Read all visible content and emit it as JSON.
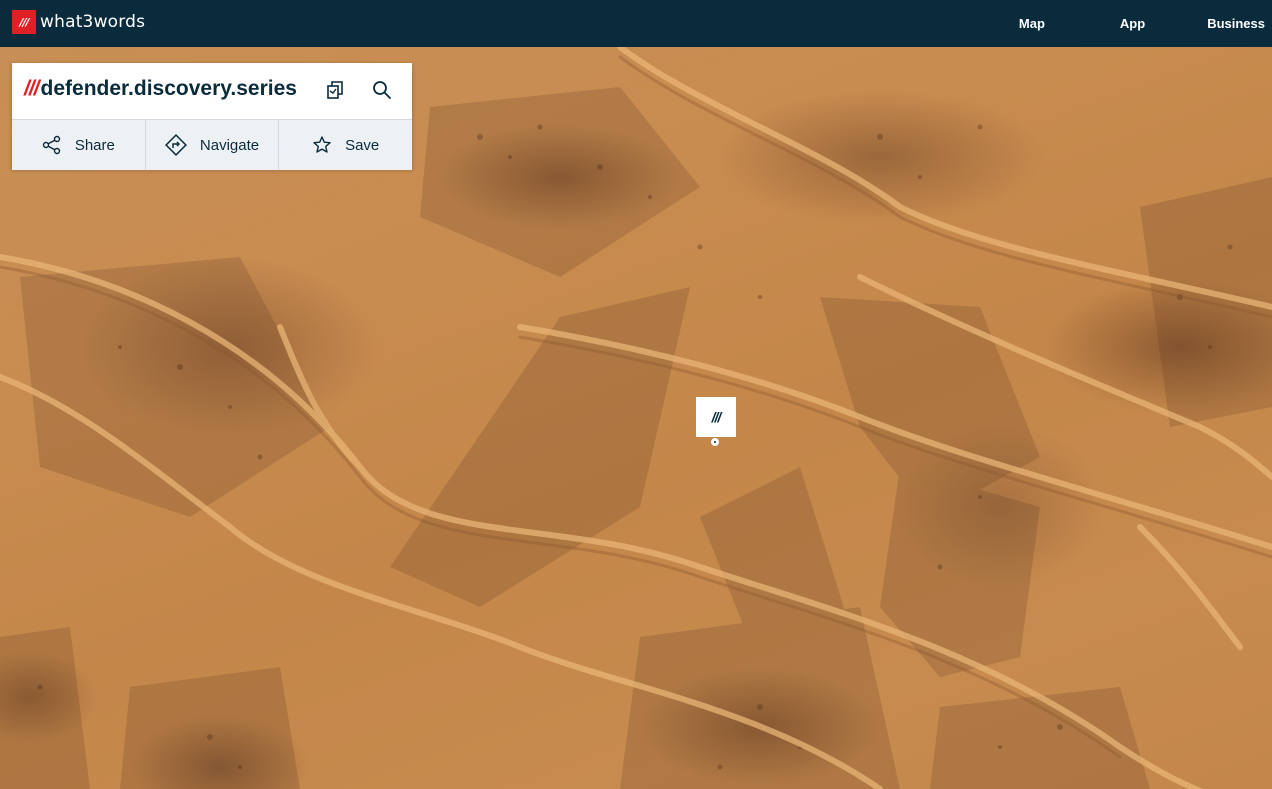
{
  "brand": {
    "mark": "///",
    "name": "what3words"
  },
  "nav": {
    "items": [
      {
        "label": "Map"
      },
      {
        "label": "App"
      },
      {
        "label": "Business"
      }
    ]
  },
  "card": {
    "prefix": "///",
    "address": "defender.discovery.series",
    "copy_icon": "copy-icon",
    "search_icon": "search-icon",
    "actions": [
      {
        "label": "Share",
        "icon": "share-icon"
      },
      {
        "label": "Navigate",
        "icon": "navigate-icon"
      },
      {
        "label": "Save",
        "icon": "star-icon"
      }
    ]
  },
  "marker": {
    "label": "///"
  },
  "colors": {
    "header_bg": "#0a2b3c",
    "brand_red": "#e11f26",
    "text_dark": "#0a2b3c",
    "actions_bg": "#eef1f4",
    "terrain": "#c78e55"
  }
}
